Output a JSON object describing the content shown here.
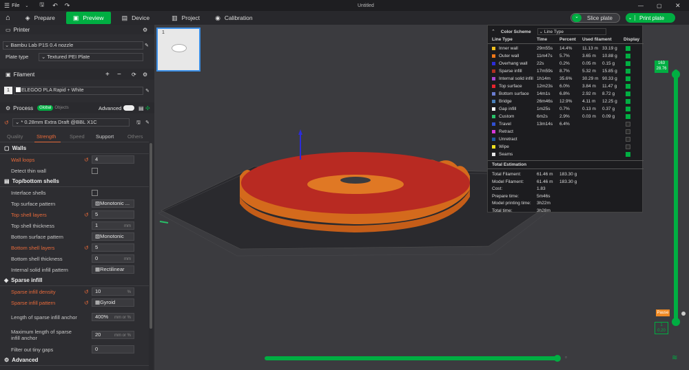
{
  "titlebar": {
    "file": "File",
    "title": "Untitled"
  },
  "nav": {
    "prepare": "Prepare",
    "preview": "Preview",
    "device": "Device",
    "project": "Project",
    "calibration": "Calibration",
    "slice": "Slice plate",
    "print": "Print plate"
  },
  "printer": {
    "header": "Printer",
    "name": "Bambu Lab P1S 0.4 nozzle",
    "plate_label": "Plate type",
    "plate_value": "Textured PEI Plate"
  },
  "filament": {
    "header": "Filament",
    "index": "1",
    "name": "ELEGOO PLA Rapid + White"
  },
  "process": {
    "header": "Process",
    "global": "Global",
    "objects": "Objects",
    "advanced": "Advanced",
    "profile": "* 0.28mm Extra Draft @BBL X1C"
  },
  "tabs": {
    "quality": "Quality",
    "strength": "Strength",
    "speed": "Speed",
    "support": "Support",
    "others": "Others"
  },
  "walls": {
    "header": "Walls",
    "wall_loops": "Wall loops",
    "wall_loops_val": "4",
    "detect_thin": "Detect thin wall"
  },
  "shells": {
    "header": "Top/bottom shells",
    "interface": "Interface shells",
    "top_pattern": "Top surface pattern",
    "top_pattern_val": "Monotonic ...",
    "top_layers": "Top shell layers",
    "top_layers_val": "5",
    "top_thickness": "Top shell thickness",
    "top_thickness_val": "1",
    "bottom_pattern": "Bottom surface pattern",
    "bottom_pattern_val": "Monotonic",
    "bottom_layers": "Bottom shell layers",
    "bottom_layers_val": "5",
    "bottom_thickness": "Bottom shell thickness",
    "bottom_thickness_val": "0",
    "internal_pattern": "Internal solid infill pattern",
    "internal_pattern_val": "Rectilinear",
    "unit_mm": "mm"
  },
  "sparse": {
    "header": "Sparse infill",
    "density": "Sparse infill density",
    "density_val": "10",
    "density_unit": "%",
    "pattern": "Sparse infill pattern",
    "pattern_val": "Gyroid",
    "length_anchor": "Length of sparse infill anchor",
    "length_anchor_val": "400%",
    "length_unit": "mm or %",
    "max_anchor": "Maximum length of sparse infill anchor",
    "max_anchor_val": "20",
    "filter_gaps": "Filter out tiny gaps",
    "filter_gaps_val": "0"
  },
  "advanced_hdr": "Advanced",
  "plate_thumb_num": "1",
  "legend": {
    "title": "Color Scheme",
    "scheme": "Line Type",
    "cols": [
      "Line Type",
      "Time",
      "Percent",
      "Used filament",
      "Display"
    ],
    "rows": [
      {
        "name": "Inner wall",
        "time": "29m55s",
        "pct": "14.4%",
        "len": "11.13 m",
        "wt": "33.19 g",
        "color": "#f0c020",
        "on": true
      },
      {
        "name": "Outer wall",
        "time": "11m47s",
        "pct": "5.7%",
        "len": "3.65 m",
        "wt": "10.88 g",
        "color": "#f07818",
        "on": true
      },
      {
        "name": "Overhang wall",
        "time": "22s",
        "pct": "0.2%",
        "len": "0.05 m",
        "wt": "0.15 g",
        "color": "#2c2cd8",
        "on": true
      },
      {
        "name": "Sparse infill",
        "time": "17m59s",
        "pct": "8.7%",
        "len": "5.32 m",
        "wt": "15.85 g",
        "color": "#b03020",
        "on": true
      },
      {
        "name": "Internal solid infill",
        "time": "1h14m",
        "pct": "35.6%",
        "len": "30.29 m",
        "wt": "90.33 g",
        "color": "#a848d0",
        "on": true
      },
      {
        "name": "Top surface",
        "time": "12m23s",
        "pct": "6.0%",
        "len": "3.84 m",
        "wt": "11.47 g",
        "color": "#e8242e",
        "on": true
      },
      {
        "name": "Bottom surface",
        "time": "14m1s",
        "pct": "6.8%",
        "len": "2.92 m",
        "wt": "8.72 g",
        "color": "#6a7cd0",
        "on": true
      },
      {
        "name": "Bridge",
        "time": "26m46s",
        "pct": "12.9%",
        "len": "4.11 m",
        "wt": "12.25 g",
        "color": "#4a80b8",
        "on": true
      },
      {
        "name": "Gap infill",
        "time": "1m25s",
        "pct": "0.7%",
        "len": "0.13 m",
        "wt": "0.37 g",
        "color": "#ffffff",
        "on": true
      },
      {
        "name": "Custom",
        "time": "6m2s",
        "pct": "2.9%",
        "len": "0.03 m",
        "wt": "0.09 g",
        "color": "#28c068",
        "on": true
      },
      {
        "name": "Travel",
        "time": "13m14s",
        "pct": "6.4%",
        "len": "",
        "wt": "",
        "color": "#3050d0",
        "on": false
      },
      {
        "name": "Retract",
        "time": "",
        "pct": "",
        "len": "",
        "wt": "",
        "color": "#d838d8",
        "on": false
      },
      {
        "name": "Unretract",
        "time": "",
        "pct": "",
        "len": "",
        "wt": "",
        "color": "#2058a0",
        "on": false
      },
      {
        "name": "Wipe",
        "time": "",
        "pct": "",
        "len": "",
        "wt": "",
        "color": "#f0e020",
        "on": false
      },
      {
        "name": "Seams",
        "time": "",
        "pct": "",
        "len": "",
        "wt": "",
        "color": "#e8e8e8",
        "on": true
      }
    ],
    "total_hdr": "Total Estimation",
    "totals": [
      {
        "label": "Total Filament:",
        "a": "61.46 m",
        "b": "183.30 g"
      },
      {
        "label": "Model Filament:",
        "a": "61.46 m",
        "b": "183.30 g"
      },
      {
        "label": "Cost:",
        "a": "1.83",
        "b": ""
      },
      {
        "label": "Prepare time:",
        "a": "5m46s",
        "b": ""
      },
      {
        "label": "Model printing time:",
        "a": "3h22m",
        "b": ""
      },
      {
        "label": "Total time:",
        "a": "3h28m",
        "b": ""
      }
    ]
  },
  "layer_slider": {
    "top1": "163",
    "top2": "28.76",
    "bottom1": "1",
    "bottom2": "0.20",
    "pause": "Pause"
  }
}
